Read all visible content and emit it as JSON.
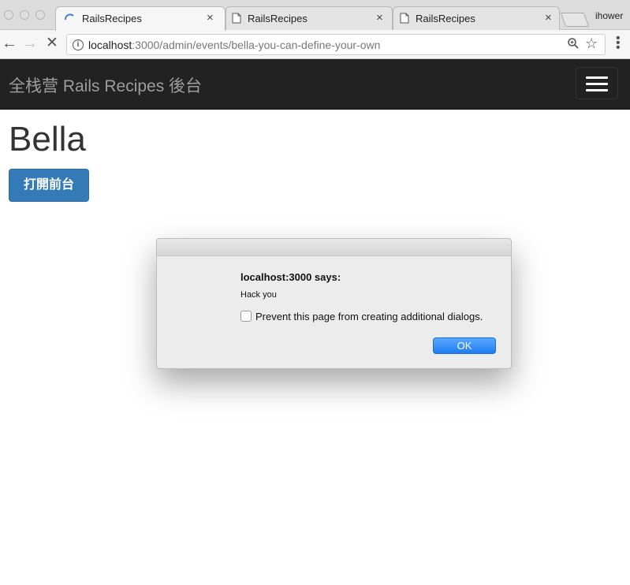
{
  "browser": {
    "tabs": [
      {
        "title": "RailsRecipes",
        "active": true,
        "loading": true
      },
      {
        "title": "RailsRecipes",
        "active": false
      },
      {
        "title": "RailsRecipes",
        "active": false
      }
    ],
    "profile_name": "ihower",
    "url_host": "localhost",
    "url_path": ":3000/admin/events/bella-you-can-define-your-own",
    "close_icon": "×"
  },
  "navbar": {
    "brand": "全栈营 Rails Recipes 後台"
  },
  "page": {
    "title": "Bella",
    "open_frontend_button": "打開前台"
  },
  "dialog": {
    "heading": "localhost:3000 says:",
    "message": "Hack you",
    "checkbox_label": "Prevent this page from creating additional dialogs.",
    "checkbox_checked": false,
    "ok_label": "OK"
  },
  "colors": {
    "navbar_bg": "#222222",
    "primary_button": "#337ab7",
    "ok_button": "#1e7df0"
  }
}
